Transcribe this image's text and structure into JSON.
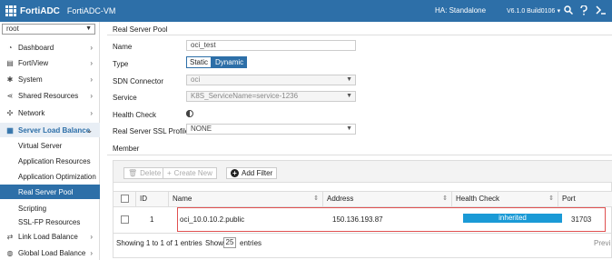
{
  "header": {
    "brand": "FortiADC",
    "device_name": "FortiADC-VM",
    "ha_label": "HA:",
    "ha_status": "Standalone",
    "version_label": "V6.1.0 Build0106",
    "version_caret": "▾",
    "accent": "#2d6fa8"
  },
  "vdom": {
    "value": "root"
  },
  "sidebar": {
    "items": [
      {
        "label": "Dashboard",
        "icon": "dashboard-icon"
      },
      {
        "label": "FortiView",
        "icon": "fortiview-icon"
      },
      {
        "label": "System",
        "icon": "gear-icon"
      },
      {
        "label": "Shared Resources",
        "icon": "share-icon"
      },
      {
        "label": "Network",
        "icon": "network-icon"
      },
      {
        "label": "Server Load Balance",
        "icon": "server-icon"
      }
    ],
    "sub_items": [
      {
        "label": "Virtual Server"
      },
      {
        "label": "Application Resources"
      },
      {
        "label": "Application Optimization"
      },
      {
        "label": "Real Server Pool"
      },
      {
        "label": "Scripting"
      },
      {
        "label": "SSL-FP Resources"
      }
    ],
    "bottom_items": [
      {
        "label": "Link Load Balance",
        "icon": "link-icon"
      },
      {
        "label": "Global Load Balance",
        "icon": "globe-icon"
      }
    ]
  },
  "page": {
    "title": "Real Server Pool",
    "form": {
      "name_label": "Name",
      "name_value": "oci_test",
      "type_label": "Type",
      "type_static": "Static",
      "type_dynamic": "Dynamic",
      "sdn_label": "SDN Connector",
      "sdn_value": "oci",
      "service_label": "Service",
      "service_value": "K8S_ServiceName=service-1236",
      "health_check_label": "Health Check",
      "ssl_profile_label": "Real Server SSL Profile",
      "ssl_profile_value": "NONE"
    },
    "member_label": "Member"
  },
  "member_table": {
    "toolbar": {
      "delete": "Delete",
      "create_new": "Create New",
      "add_filter": "Add Filter"
    },
    "columns": [
      "ID",
      "Name",
      "Address",
      "Health Check",
      "Port"
    ],
    "rows": [
      {
        "id": "1",
        "name": "oci_10.0.10.2.public",
        "address": "150.136.193.87",
        "health_check": "inherited",
        "port": "31703"
      }
    ],
    "footer": {
      "showing": "Showing 1 to 1 of 1 entries",
      "show_label": "Show",
      "page_size": "25",
      "entries_label": "entries",
      "previous": "Previ"
    }
  }
}
